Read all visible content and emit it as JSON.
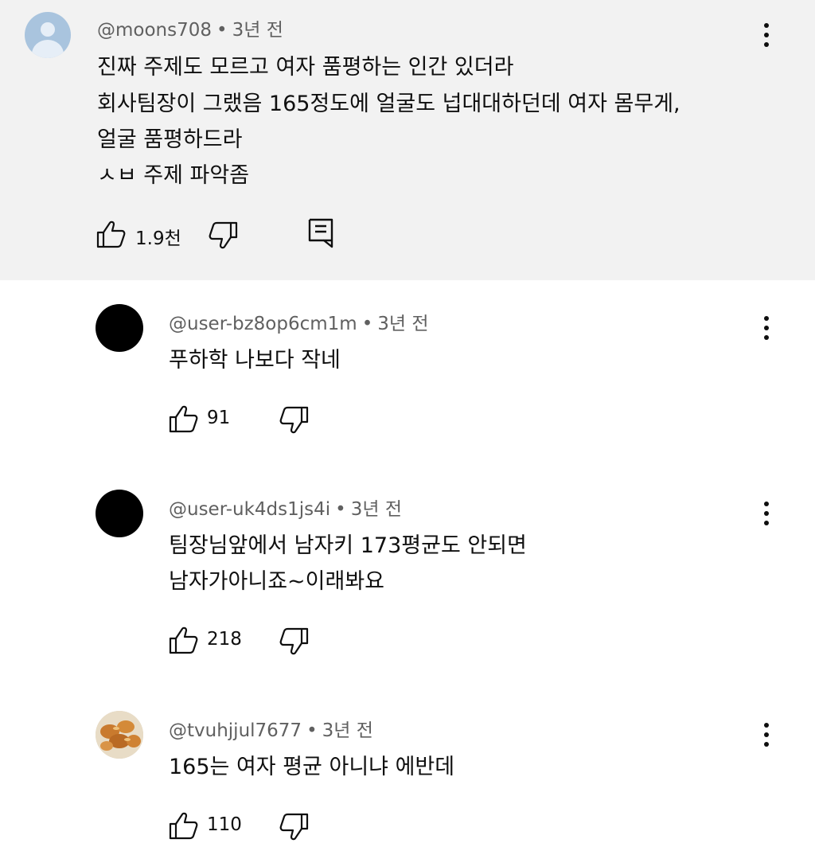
{
  "comments": [
    {
      "username": "@moons708",
      "time": "3년 전",
      "lines": [
        "진짜 주제도 모르고 여자 품평하는 인간 있더라",
        "회사팀장이 그랬음 165정도에 얼굴도 넙대대하던데 여자 몸무게,",
        "얼굴 품평하드라",
        "ㅅㅂ 주제 파악좀"
      ],
      "likes": "1.9천",
      "avatar_icon": "default-avatar-icon"
    },
    {
      "username": "@user-bz8op6cm1m",
      "time": "3년 전",
      "lines": [
        "푸하학 나보다 작네"
      ],
      "likes": "91"
    },
    {
      "username": "@user-uk4ds1js4i",
      "time": "3년 전",
      "lines": [
        "팀장님앞에서 남자키 173평균도 안되면",
        "남자가아니죠~이래봐요"
      ],
      "likes": "218"
    },
    {
      "username": "@tvuhjjul7677",
      "time": "3년 전",
      "lines": [
        "165는 여자 평균 아니냐 에반데"
      ],
      "likes": "110"
    }
  ],
  "separator": "•",
  "icons": {
    "like": "thumbs-up-icon",
    "dislike": "thumbs-down-icon",
    "reply": "reply-comment-icon",
    "menu": "more-vertical-icon"
  },
  "colors": {
    "highlight_background": "#f2f2f2",
    "meta_text": "#606060",
    "text": "#0f0f0f"
  }
}
